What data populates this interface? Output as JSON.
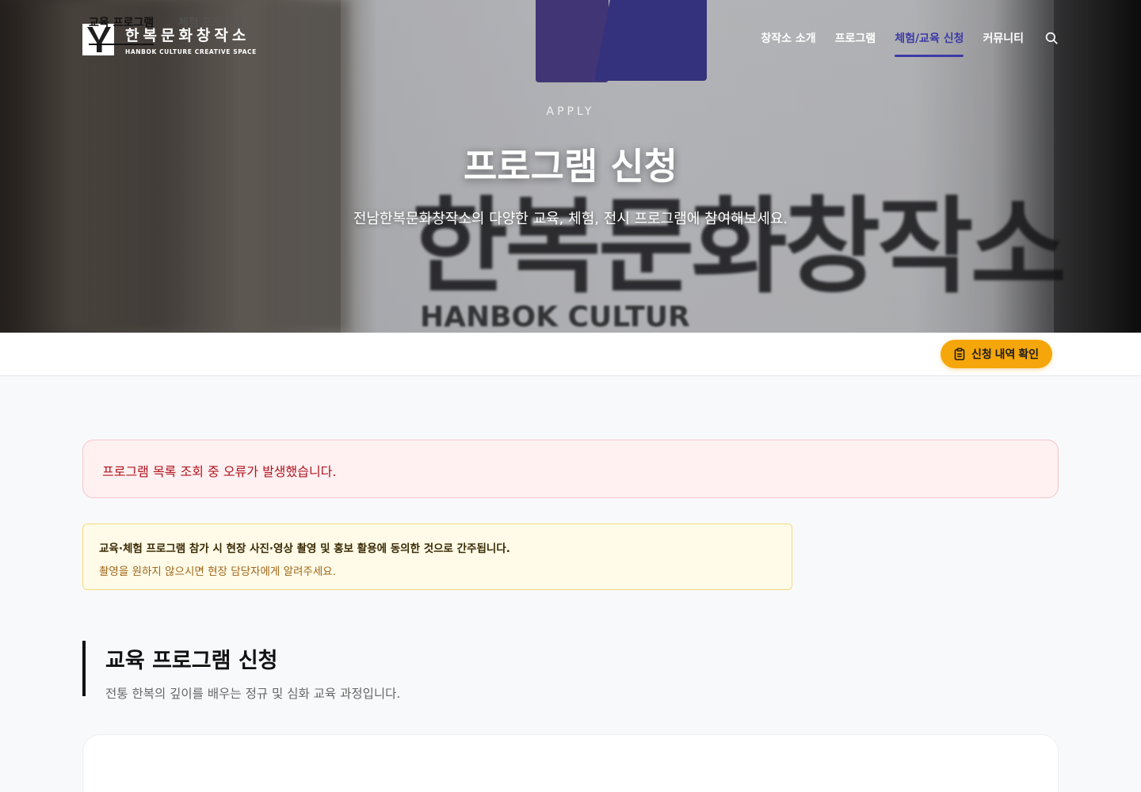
{
  "header": {
    "logo_ko": "한복문화창작소",
    "logo_en": "HANBOK CULTURE CREATIVE SPACE",
    "nav": [
      {
        "label": "창작소 소개",
        "active": false
      },
      {
        "label": "프로그램",
        "active": false
      },
      {
        "label": "체험/교육 신청",
        "active": true
      },
      {
        "label": "커뮤니티",
        "active": false
      }
    ],
    "search_icon": "search-icon"
  },
  "hero": {
    "eyebrow": "APPLY",
    "title": "프로그램 신청",
    "subtitle": "전남한복문화창작소의 다양한 교육, 체험, 전시 프로그램에 참여해보세요.",
    "background_sign_text": "한복문화창작소",
    "background_sign_sub": "HANBOK CULTUR"
  },
  "tabs": {
    "items": [
      {
        "label": "교육 프로그램",
        "active": true
      },
      {
        "label": "체험 프로그램",
        "active": false
      }
    ],
    "status_button": "신청 내역 확인",
    "accent": "#f5a60a"
  },
  "error": {
    "message": "프로그램 목록 조회 중 오류가 발생했습니다."
  },
  "notice": {
    "strong": "교육·체험 프로그램 참가 시 현장 사진·영상 촬영 및 홍보 활용에 동의한 것으로 간주됩니다.",
    "sub": "촬영을 원하지 않으시면 현장 담당자에게 알려주세요."
  },
  "section": {
    "title": "교육 프로그램 신청",
    "description": "전통 한복의 깊이를 배우는 정규 및 심화 교육 과정입니다."
  },
  "colors": {
    "nav_active": "#3d3aa6",
    "error_text": "#b0151f",
    "notice_text": "#a0661a"
  }
}
